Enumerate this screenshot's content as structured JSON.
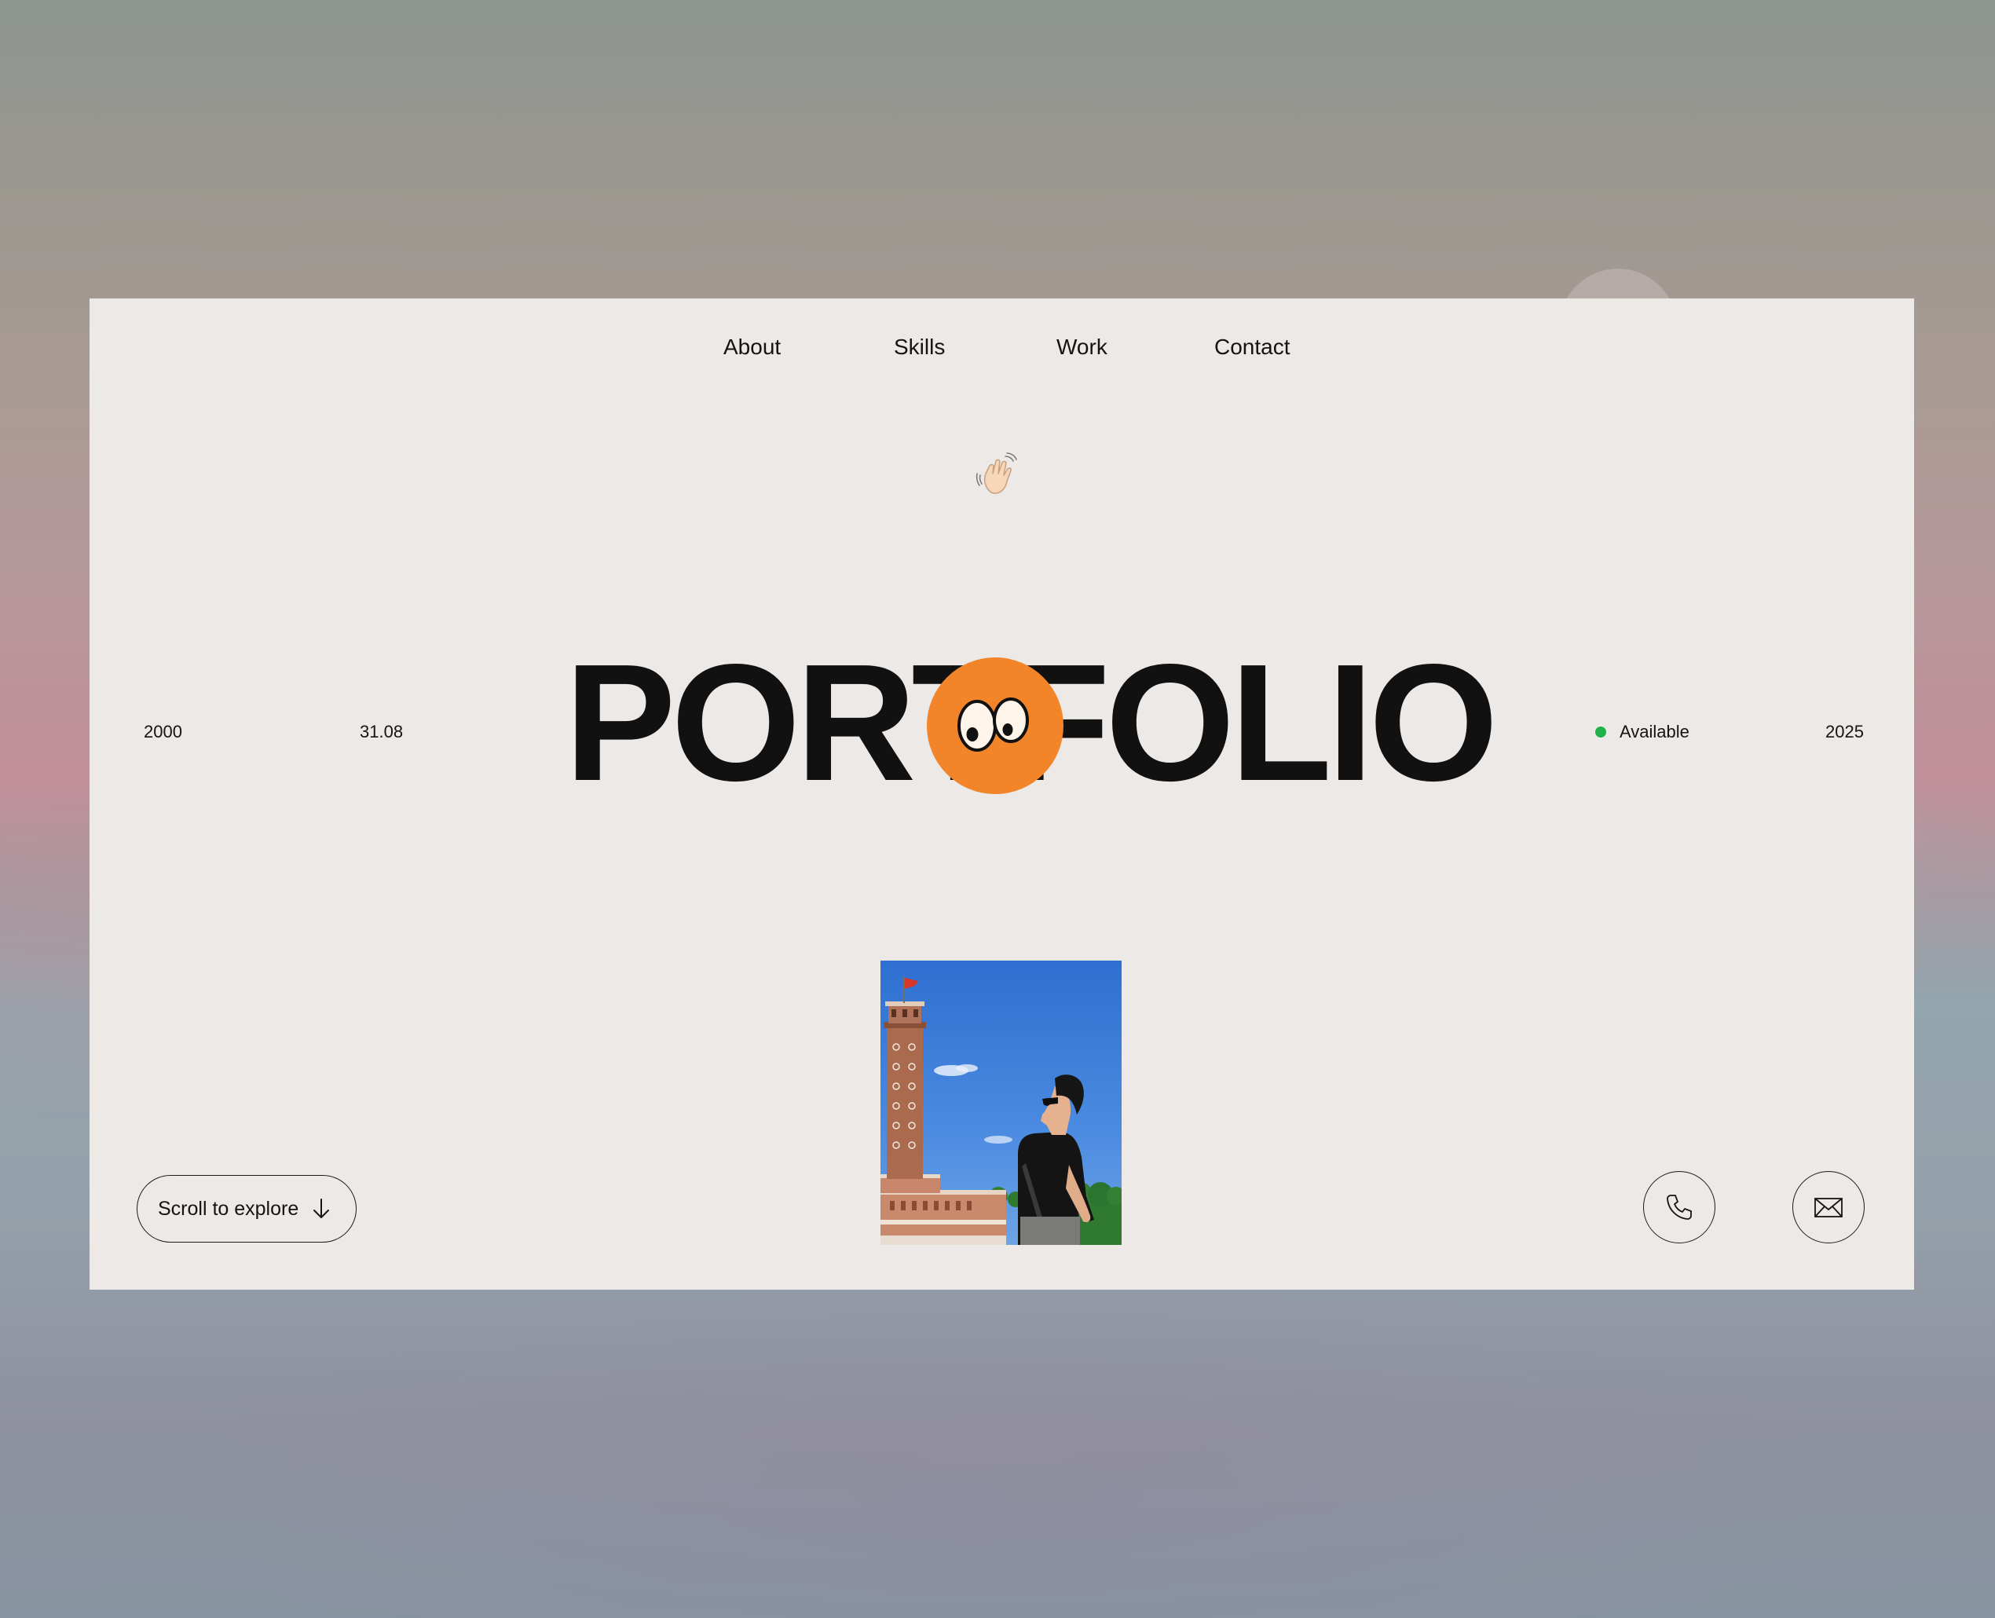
{
  "nav": {
    "items": [
      {
        "label": "About"
      },
      {
        "label": "Skills"
      },
      {
        "label": "Work"
      },
      {
        "label": "Contact"
      }
    ]
  },
  "hero": {
    "title": "PORTFOLIO",
    "wave_emoji": "waving-hand-icon",
    "badge_icon": "eyes-icon",
    "accent_color": "#f2852a"
  },
  "meta": {
    "birth_year": "2000",
    "birth_date": "31.08",
    "status": "Available",
    "status_color": "#1fb14b",
    "current_year": "2025"
  },
  "actions": {
    "scroll_label": "Scroll to explore",
    "scroll_icon": "arrow-down-icon",
    "phone_icon": "phone-icon",
    "mail_icon": "mail-icon"
  },
  "photo": {
    "subject": "portrait-photo"
  }
}
